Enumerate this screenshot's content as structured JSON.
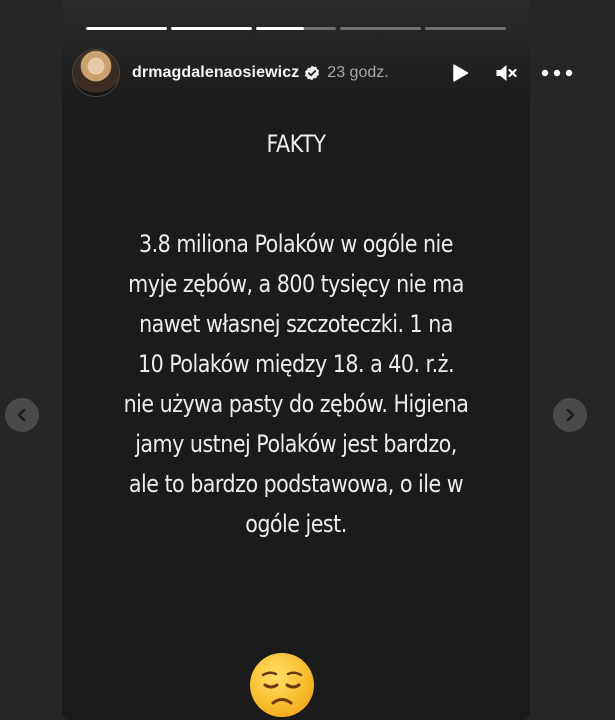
{
  "story": {
    "username": "drmagdalenaosiewicz",
    "timestamp": "23 godz.",
    "progress": [
      1.0,
      1.0,
      0.6,
      0.0,
      0.0
    ],
    "title": "FAKTY",
    "body_lines": [
      "3.8 miliona Polaków w ogóle nie",
      "myje zębów, a 800 tysięcy nie ma",
      "nawet własnej szczoteczki. 1 na",
      "10 Polaków między 18. a 40. r.ż.",
      "nie używa pasty do zębów. Higiena",
      "jamy ustnej Polaków jest bardzo,",
      "ale to bardzo podstawowa, o ile w",
      "ogóle jest."
    ],
    "emoji": "disappointed-face"
  },
  "icons": {
    "verified": "verified-badge-icon",
    "play": "play-icon",
    "mute": "muted-speaker-icon",
    "more": "more-options-icon",
    "prev": "chevron-left-icon",
    "next": "chevron-right-icon"
  },
  "colors": {
    "page_bg": "#262626",
    "story_bg": "#1b1b1b",
    "text": "#ececec",
    "muted_text": "#a8a8a8",
    "emoji_yellow": "#f7b928"
  }
}
